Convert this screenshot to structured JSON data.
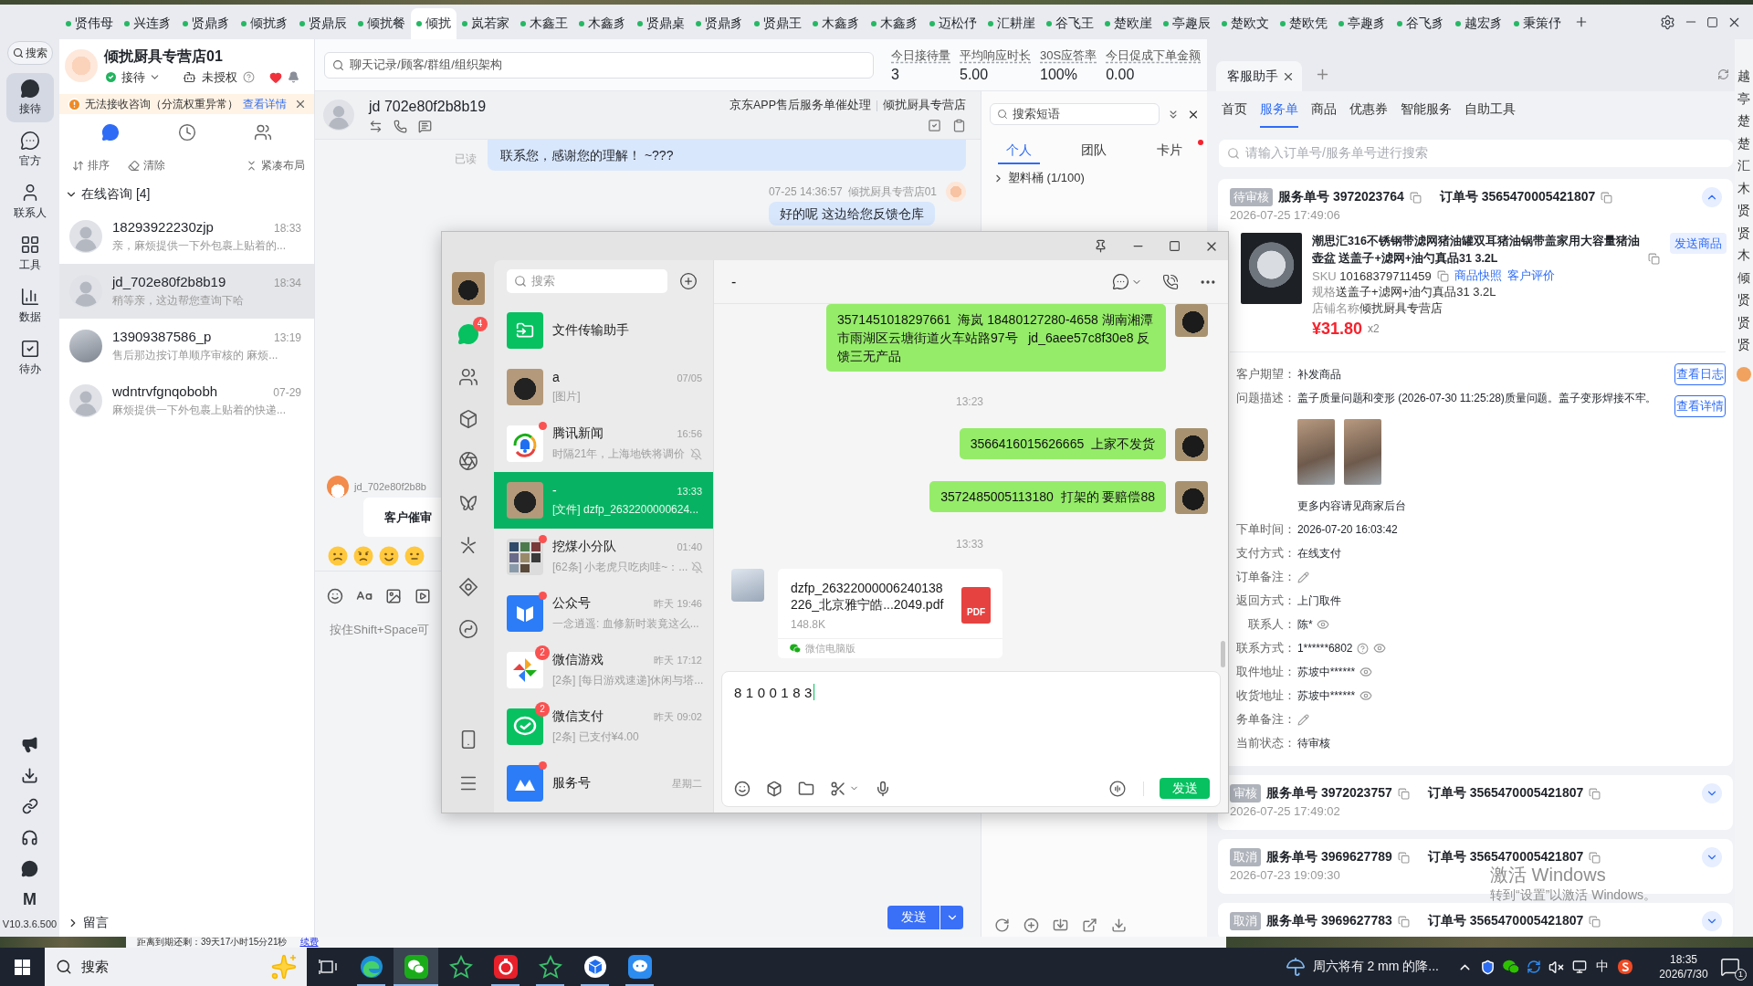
{
  "top_tabs": [
    {
      "label": "贤伟母",
      "selected": false
    },
    {
      "label": "兴连豸",
      "selected": false
    },
    {
      "label": "贤鼎豸",
      "selected": false
    },
    {
      "label": "倾扰豸",
      "selected": false
    },
    {
      "label": "贤鼎辰",
      "selected": false
    },
    {
      "label": "倾扰餐",
      "selected": false
    },
    {
      "label": "倾扰",
      "selected": true
    },
    {
      "label": "岚若家",
      "selected": false
    },
    {
      "label": "木鑫王",
      "selected": false
    },
    {
      "label": "木鑫豸",
      "selected": false
    },
    {
      "label": "贤鼎桌",
      "selected": false
    },
    {
      "label": "贤鼎豸",
      "selected": false
    },
    {
      "label": "贤鼎王",
      "selected": false
    },
    {
      "label": "木鑫豸",
      "selected": false
    },
    {
      "label": "木鑫豸",
      "selected": false
    },
    {
      "label": "迈松伃",
      "selected": false
    },
    {
      "label": "汇耕崖",
      "selected": false
    },
    {
      "label": "谷飞王",
      "selected": false
    },
    {
      "label": "楚欧崖",
      "selected": false
    },
    {
      "label": "亭趣辰",
      "selected": false
    },
    {
      "label": "楚欧文",
      "selected": false
    },
    {
      "label": "楚欧凭",
      "selected": false
    },
    {
      "label": "亭趣豸",
      "selected": false
    },
    {
      "label": "谷飞豸",
      "selected": false
    },
    {
      "label": "越宏豸",
      "selected": false
    },
    {
      "label": "秉策伃",
      "selected": false
    }
  ],
  "sidebar": {
    "search": "搜索",
    "items": [
      {
        "label": "接待",
        "selected": true
      },
      {
        "label": "官方",
        "selected": false
      },
      {
        "label": "联系人",
        "selected": false
      },
      {
        "label": "工具",
        "selected": false
      },
      {
        "label": "数据",
        "selected": false
      },
      {
        "label": "待办",
        "selected": false
      }
    ],
    "mark": "M",
    "version": "V10.3.6.500"
  },
  "shop": {
    "name": "倾扰厨具专营店01",
    "online": true,
    "status": "接待",
    "authorization": "未授权"
  },
  "alert": {
    "text": "无法接收咨询（分流权重异常）",
    "link": "查看详情"
  },
  "list_views": [
    {
      "selected": true
    },
    {
      "selected": false
    },
    {
      "selected": false
    }
  ],
  "list_actions": [
    "排序",
    "清除",
    "紧凑布局"
  ],
  "queue": {
    "label": "在线咨询 [4]",
    "expanded": true,
    "conversations": [
      {
        "kind": "default",
        "name": "18293922230zjp",
        "time": "18:33",
        "preview": "亲，麻烦提供一下外包裹上贴着的...",
        "selected": false
      },
      {
        "kind": "default",
        "name": "jd_702e80f2b8b19",
        "time": "18:34",
        "preview": "稍等亲，这边帮您查询下哈",
        "selected": true
      },
      {
        "kind": "photo",
        "name": "13909387586_p",
        "time": "13:19",
        "preview": "售后那边按订单顺序审核的 麻烦...",
        "selected": false
      },
      {
        "kind": "default",
        "name": "wdntrvfgnqobobh",
        "time": "07-29",
        "preview": "麻烦提供一下外包裹上贴着的快递...",
        "selected": false
      }
    ]
  },
  "message_box": {
    "label": "留言",
    "expanded": false
  },
  "workspace": {
    "search_placeholder": "聊天记录/顾客/群组/组织架构",
    "stats": [
      {
        "label": "今日接待量",
        "value": "3"
      },
      {
        "label": "平均响应时长",
        "value": "5.00"
      },
      {
        "label": "30S应答率",
        "value": "100%"
      },
      {
        "label": "今日促成下单金额",
        "value": "0.00"
      }
    ]
  },
  "chat": {
    "title": "jd 702e80f2b8b19",
    "topic": "京东APP售后服务单催处理",
    "shop": "倾扰厨具专营店",
    "messages": [
      {
        "kind": "outgoing_tail",
        "text": "联系您，感谢您的理解！ ~???",
        "receipt": "已读"
      },
      {
        "kind": "outgoing",
        "time": "07-25 14:36:57",
        "sender": "倾扰厨具专营店01",
        "text": "好的呢 这边给您反馈仓库"
      },
      {
        "kind": "incoming_card",
        "sender": "jd_702e80f2b8b",
        "text": "客户催审"
      }
    ],
    "placeholder": "按住Shift+Space可",
    "send": "发送"
  },
  "phrases": {
    "placeholder": "搜索短语",
    "tabs": [
      {
        "label": "个人",
        "selected": true,
        "unread": false
      },
      {
        "label": "团队",
        "selected": false,
        "unread": false
      },
      {
        "label": "卡片",
        "selected": false,
        "unread": true
      }
    ],
    "groups": [
      {
        "label": "塑料桶 (1/100)",
        "expanded": false
      }
    ]
  },
  "assistant": {
    "tabs": [
      {
        "label": "客服助手",
        "selected": true
      }
    ],
    "sections": [
      {
        "label": "首页",
        "selected": false
      },
      {
        "label": "服务单",
        "selected": true
      },
      {
        "label": "商品",
        "selected": false
      },
      {
        "label": "优惠券",
        "selected": false
      },
      {
        "label": "智能服务",
        "selected": false
      },
      {
        "label": "自助工具",
        "selected": false
      }
    ],
    "search_placeholder": "请输入订单号/服务单号进行搜索",
    "cards": [
      {
        "status": "待审核",
        "service": "服务单号 3972023764",
        "order": "订单号 3565470005421807",
        "date": "2026-07-25 17:49:06",
        "expanded": true,
        "product": {
          "title": "潮思汇316不锈钢带滤网猪油罐双耳猪油锅带盖家用大容量猪油壶盆 送盖子+滤网+油勺真品31 3.2L",
          "sku": {
            "label": "SKU",
            "value": "10168379711459"
          },
          "links": [
            "商品快照",
            "客户评价"
          ],
          "spec": {
            "label": "规格",
            "value": "送盖子+滤网+油勺真品31 3.2L"
          },
          "shop": {
            "label": "店铺名称",
            "value": "倾扰厨具专营店"
          },
          "price": "¥31.80",
          "quantity": "x2",
          "action": "发送商品"
        },
        "requests": [
          {
            "label": "客户期望：",
            "value": "补发商品"
          },
          {
            "label": "问题描述：",
            "value": "盖子质量问题和变形 (2026-07-30 11:25:28)质量问题。盖子变形焊接不牢。"
          }
        ],
        "attachments": [
          {
            "kind": "photo"
          },
          {
            "kind": "photo"
          }
        ],
        "note": "更多内容请见商家后台",
        "details": [
          {
            "kind": "text",
            "label": "下单时间：",
            "value": "2026-07-20 16:03:42"
          },
          {
            "kind": "text",
            "label": "支付方式：",
            "value": "在线支付"
          },
          {
            "kind": "edit",
            "label": "订单备注："
          },
          {
            "kind": "text",
            "label": "返回方式：",
            "value": "上门取件"
          },
          {
            "kind": "masked",
            "label": "联系人：",
            "value": "陈*"
          },
          {
            "kind": "masked_help",
            "label": "联系方式：",
            "value": "1******6802"
          },
          {
            "kind": "masked",
            "label": "取件地址：",
            "value": "苏坡中******"
          },
          {
            "kind": "masked",
            "label": "收货地址：",
            "value": "苏坡中******"
          },
          {
            "kind": "edit",
            "label": "务单备注："
          },
          {
            "kind": "text",
            "label": "当前状态：",
            "value": "待审核"
          }
        ],
        "actions": [
          "查看日志",
          "查看详情"
        ]
      },
      {
        "status": "审核",
        "service": "服务单号 3972023757",
        "order": "订单号 3565470005421807",
        "date": "2026-07-25 17:49:02",
        "expanded": false
      },
      {
        "status": "取消",
        "service": "服务单号 3969627789",
        "order": "订单号 3565470005421807",
        "date": "2026-07-23 19:09:30",
        "expanded": false
      },
      {
        "status": "取消",
        "service": "服务单号 3969627783",
        "order": "订单号 3565470005421807",
        "expanded": false
      }
    ]
  },
  "side_strip": [
    "越",
    "亭",
    "楚",
    "楚",
    "汇",
    "木",
    "贤",
    "贤",
    "木",
    "倾",
    "贤",
    "贤",
    "贤"
  ],
  "wechat": {
    "nav_badge": "4",
    "search_placeholder": "搜索",
    "chats": [
      {
        "kind": "file_transfer",
        "name": "文件传输助手",
        "selected": false,
        "unread_dot": false,
        "muted": false
      },
      {
        "kind": "photo",
        "name": "a",
        "time": "07/05",
        "preview": "[图片]",
        "selected": false,
        "unread_dot": false,
        "muted": false
      },
      {
        "kind": "news",
        "name": "腾讯新闻",
        "time": "16:56",
        "preview": "时隔21年，上海地铁将调价",
        "selected": false,
        "unread_dot": true,
        "muted": true
      },
      {
        "kind": "photo",
        "name": "-",
        "time": "13:33",
        "preview": "[文件] dzfp_2632200000624...",
        "selected": true,
        "unread_dot": false,
        "muted": false
      },
      {
        "kind": "group",
        "name": "挖煤小分队",
        "time": "01:40",
        "preview": "[62条] 小老虎只吃肉哇~：...",
        "selected": false,
        "unread_dot": true,
        "muted": true
      },
      {
        "kind": "official",
        "name": "公众号",
        "time": "昨天 19:46",
        "preview": "一念逍遥: 血修新时装竟这么...",
        "selected": false,
        "unread_dot": true,
        "muted": false
      },
      {
        "kind": "games",
        "name": "微信游戏",
        "time": "昨天 17:12",
        "preview": "[2条] [每日游戏速递]休闲与塔...",
        "selected": false,
        "unread_dot": false,
        "muted": false,
        "badge": "2"
      },
      {
        "kind": "pay",
        "name": "微信支付",
        "time": "昨天 09:02",
        "preview": "[2条] 已支付¥4.00",
        "selected": false,
        "unread_dot": false,
        "muted": false,
        "badge": "2"
      },
      {
        "kind": "service",
        "name": "服务号",
        "time": "星期二",
        "selected": false,
        "unread_dot": true,
        "muted": false
      }
    ],
    "title": "-",
    "messages": [
      {
        "kind": "sent",
        "text": "3571451018297661  海岚 18480127280-4658 湖南湘潭市雨湖区云塘街道火车站路97号   jd_6aee57c8f30e8 反馈三无产品"
      },
      {
        "kind": "time",
        "text": "13:23"
      },
      {
        "kind": "sent",
        "text": "3566416015626665  上家不发货"
      },
      {
        "kind": "sent",
        "text": "3572485005113180  打架的 要赔偿88"
      },
      {
        "kind": "time",
        "text": "13:33"
      },
      {
        "kind": "file",
        "name": "dzfp_26322000006240138226_北京雅宁皓...2049.pdf",
        "type": "PDF",
        "size": "148.8K",
        "source": "微信电脑版"
      }
    ],
    "draft": "8100183",
    "send": "发送"
  },
  "bottom_notice": {
    "text": "距离到期还剩：39天17小时15分21秒",
    "link": "续费"
  },
  "taskbar": {
    "search_placeholder": "搜索",
    "apps": [
      {
        "selected": false,
        "running": true
      },
      {
        "selected": true,
        "running": true
      },
      {
        "selected": false,
        "running": false
      },
      {
        "selected": false,
        "running": true
      },
      {
        "selected": false,
        "running": true
      },
      {
        "selected": false,
        "running": true
      },
      {
        "selected": false,
        "running": true
      }
    ],
    "weather": "周六将有 2 mm 的降...",
    "input_mode": "中",
    "time": "18:35",
    "date": "2026/7/30",
    "notification_count": "1"
  },
  "activation": {
    "title": "激活 Windows",
    "text": "转到“设置”以激活 Windows。"
  }
}
